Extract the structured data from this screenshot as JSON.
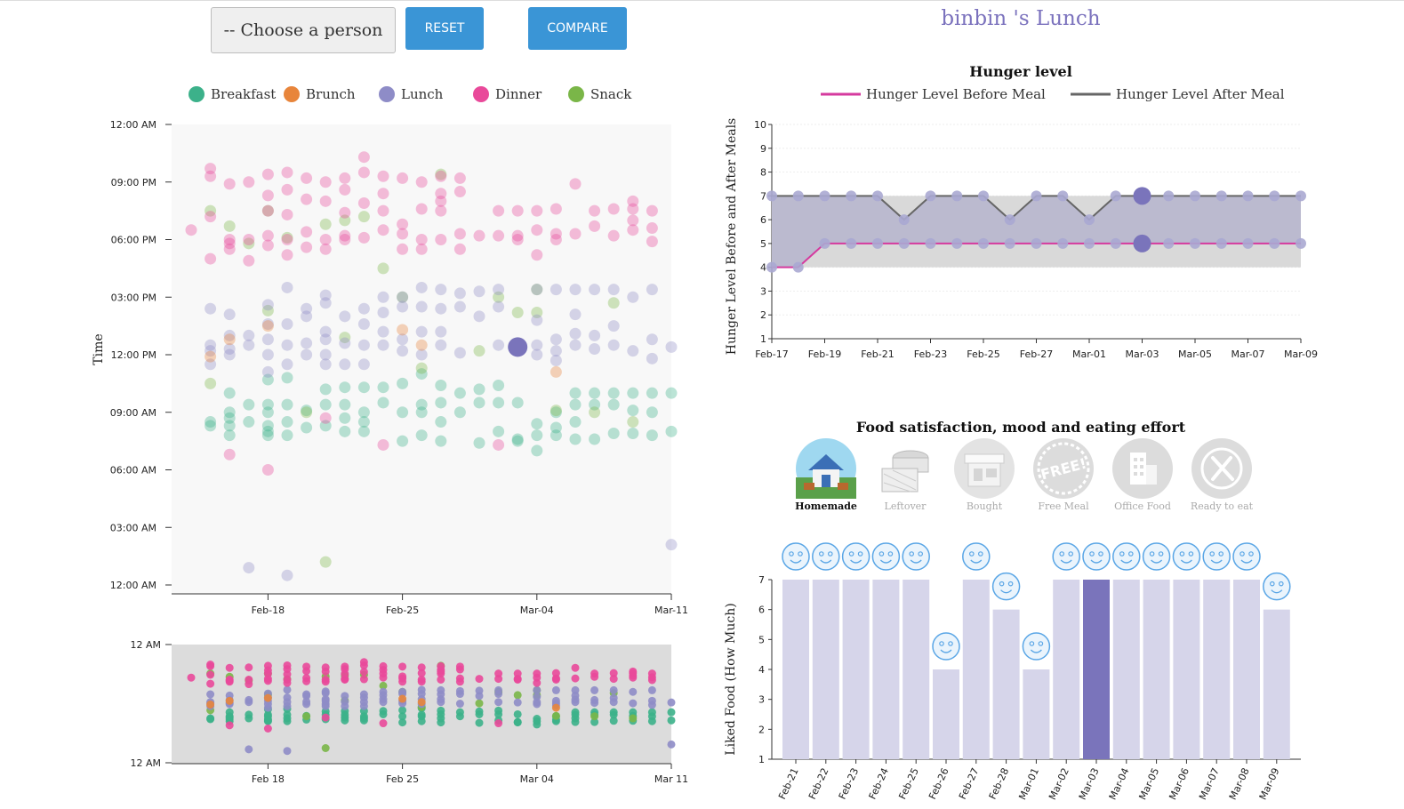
{
  "controls": {
    "person_placeholder": "-- Choose a person",
    "reset_label": "RESET",
    "compare_label": "COMPARE"
  },
  "page_title": "binbin 's Lunch",
  "colors": {
    "breakfast": "#3cb18a",
    "brunch": "#e8853b",
    "lunch": "#8e8cc7",
    "dinner": "#e9499a",
    "snack": "#7ab648",
    "highlight": "#7a74bb",
    "bar": "#d6d5ea",
    "bar_selected": "#7a74bb",
    "smiley": "#5aa6e6",
    "button": "#3a95d6",
    "hunger_before": "#d53a9e",
    "hunger_after": "#666666"
  },
  "meal_legend": [
    {
      "label": "Breakfast",
      "color": "#3cb18a"
    },
    {
      "label": "Brunch",
      "color": "#e8853b"
    },
    {
      "label": "Lunch",
      "color": "#8e8cc7"
    },
    {
      "label": "Dinner",
      "color": "#e9499a"
    },
    {
      "label": "Snack",
      "color": "#7ab648"
    }
  ],
  "chart_data": [
    {
      "type": "scatter",
      "name": "meal-times",
      "ylabel": "Time",
      "y_ticks": [
        "12:00 AM",
        "03:00 AM",
        "06:00 AM",
        "09:00 AM",
        "12:00 PM",
        "03:00 PM",
        "06:00 PM",
        "09:00 PM",
        "12:00 AM"
      ],
      "x_ticks": [
        "Feb-18",
        "Feb-25",
        "Mar-04",
        "Mar-11"
      ],
      "x_range": [
        "2018-02-14",
        "2018-03-11"
      ],
      "y_range_hours": [
        0,
        24
      ],
      "selected_point": {
        "date": "2018-03-03",
        "hour": 12.4,
        "meal": "Lunch"
      },
      "points": [
        {
          "d": "2018-02-14",
          "meals": {
            "dinner": [
              18.5
            ]
          }
        },
        {
          "d": "2018-02-15",
          "meals": {
            "breakfast": [
              8.3,
              8.5
            ],
            "brunch": [
              11.9
            ],
            "lunch": [
              11.5,
              12.2,
              12.5,
              14.4
            ],
            "dinner": [
              17,
              19.2,
              21.3,
              21.7
            ],
            "snack": [
              19.5,
              10.5
            ]
          }
        },
        {
          "d": "2018-02-16",
          "meals": {
            "breakfast": [
              7.8,
              8.3,
              8.7,
              9,
              10
            ],
            "brunch": [
              12.8
            ],
            "lunch": [
              12,
              12.3,
              13,
              14.1
            ],
            "dinner": [
              6.8,
              17.5,
              17.8,
              18,
              20.9
            ],
            "snack": [
              18.7
            ]
          }
        },
        {
          "d": "2018-02-17",
          "meals": {
            "breakfast": [
              8.5,
              9.4
            ],
            "lunch": [
              12.5,
              13,
              0.9
            ],
            "dinner": [
              16.9,
              18,
              21
            ],
            "snack": [
              17.8
            ]
          }
        },
        {
          "d": "2018-02-18",
          "meals": {
            "breakfast": [
              7.8,
              8,
              8.3,
              9,
              9.4,
              10.7
            ],
            "brunch": [
              13.5
            ],
            "lunch": [
              11.1,
              12,
              12.8,
              13.6,
              14.6
            ],
            "dinner": [
              6,
              17.7,
              18.2,
              19.5,
              20.3,
              21.4
            ],
            "snack": [
              14.3,
              19.5
            ]
          }
        },
        {
          "d": "2018-02-19",
          "meals": {
            "breakfast": [
              7.8,
              8.5,
              9.4,
              10.8
            ],
            "lunch": [
              11.5,
              12.5,
              13.6,
              15.5,
              0.5
            ],
            "dinner": [
              17.2,
              18,
              19.3,
              20.6,
              21.5
            ],
            "snack": [
              18.1
            ]
          }
        },
        {
          "d": "2018-02-20",
          "meals": {
            "breakfast": [
              8.2,
              9.1
            ],
            "lunch": [
              12,
              12.6,
              14,
              14.4
            ],
            "dinner": [
              17.6,
              18.4,
              20.1,
              21.2
            ],
            "snack": [
              9
            ]
          }
        },
        {
          "d": "2018-02-21",
          "meals": {
            "breakfast": [
              8.3,
              9.4,
              10.2
            ],
            "lunch": [
              11.5,
              12,
              12.8,
              13.2,
              14.7,
              15.1
            ],
            "dinner": [
              8.7,
              17.5,
              18,
              20,
              21
            ],
            "snack": [
              18.8,
              1.2
            ]
          }
        },
        {
          "d": "2018-02-22",
          "meals": {
            "breakfast": [
              8,
              8.7,
              9.4,
              10.3
            ],
            "lunch": [
              11.5,
              12.6,
              14
            ],
            "dinner": [
              18,
              18.2,
              19.4,
              20.6,
              21.2
            ],
            "snack": [
              12.9,
              19
            ]
          }
        },
        {
          "d": "2018-02-23",
          "meals": {
            "breakfast": [
              8,
              8.5,
              9,
              10.3
            ],
            "lunch": [
              11.5,
              12.5,
              13.6,
              14.4
            ],
            "dinner": [
              18.1,
              19.9,
              21.5,
              22.3
            ],
            "snack": [
              19.2
            ]
          }
        },
        {
          "d": "2018-02-24",
          "meals": {
            "breakfast": [
              9.5,
              10.3
            ],
            "lunch": [
              12.5,
              13.2,
              14.2,
              15
            ],
            "dinner": [
              7.3,
              18.5,
              19.5,
              20.4,
              21.3
            ],
            "snack": [
              16.5
            ]
          }
        },
        {
          "d": "2018-02-25",
          "meals": {
            "breakfast": [
              7.5,
              9,
              10.5
            ],
            "brunch": [
              13.3
            ],
            "lunch": [
              12.2,
              12.8,
              14.5,
              15
            ],
            "dinner": [
              17.5,
              18.3,
              18.8,
              21.2
            ],
            "snack": [
              15
            ]
          }
        },
        {
          "d": "2018-02-26",
          "meals": {
            "breakfast": [
              7.8,
              9,
              9.4,
              11
            ],
            "brunch": [
              12.5
            ],
            "lunch": [
              12,
              13.2,
              14.5,
              15.5
            ],
            "dinner": [
              17.5,
              18,
              19.6,
              21
            ],
            "snack": [
              11.3
            ]
          }
        },
        {
          "d": "2018-02-27",
          "meals": {
            "breakfast": [
              7.5,
              8.5,
              9.5,
              10.4
            ],
            "lunch": [
              12.5,
              13.2,
              14.4,
              15.4
            ],
            "dinner": [
              18,
              19.5,
              20,
              20.4,
              21.3
            ],
            "snack": [
              21.4
            ]
          }
        },
        {
          "d": "2018-02-28",
          "meals": {
            "breakfast": [
              9,
              10
            ],
            "lunch": [
              12.1,
              14.5,
              15.2
            ],
            "dinner": [
              17.5,
              18.3,
              20.5,
              21.2
            ],
            "snack": []
          }
        },
        {
          "d": "2018-03-01",
          "meals": {
            "breakfast": [
              7.4,
              9.5,
              10.2
            ],
            "lunch": [
              14,
              15.3
            ],
            "dinner": [
              18.2
            ],
            "snack": [
              12.2
            ]
          }
        },
        {
          "d": "2018-03-02",
          "meals": {
            "breakfast": [
              8,
              9.5,
              10.4
            ],
            "lunch": [
              12.5,
              14.5,
              15.4
            ],
            "dinner": [
              7.3,
              18.2,
              19.5
            ],
            "snack": [
              15
            ]
          }
        },
        {
          "d": "2018-03-03",
          "meals": {
            "breakfast": [
              7.5,
              7.6,
              9.5
            ],
            "lunch": [
              12.4
            ],
            "dinner": [
              18,
              18.2,
              19.5
            ],
            "snack": [
              14.2
            ]
          }
        },
        {
          "d": "2018-03-04",
          "meals": {
            "breakfast": [
              7,
              7.8,
              8.4
            ],
            "lunch": [
              12,
              12.5,
              13.8,
              15.4
            ],
            "dinner": [
              17.2,
              18.5,
              19.5
            ],
            "snack": [
              14.2,
              15.4
            ]
          }
        },
        {
          "d": "2018-03-05",
          "meals": {
            "breakfast": [
              7.8,
              8.2,
              9
            ],
            "brunch": [
              11.1
            ],
            "lunch": [
              11.7,
              12.2,
              12.8,
              15.4
            ],
            "dinner": [
              18,
              18.3,
              19.6
            ],
            "snack": [
              9.1
            ]
          }
        },
        {
          "d": "2018-03-06",
          "meals": {
            "breakfast": [
              7.6,
              8.5,
              9.4,
              10
            ],
            "lunch": [
              12.5,
              13.1,
              14.1,
              15.4
            ],
            "dinner": [
              18.3,
              20.9
            ],
            "snack": []
          }
        },
        {
          "d": "2018-03-07",
          "meals": {
            "breakfast": [
              7.6,
              9.4,
              10
            ],
            "lunch": [
              12.3,
              13,
              15.4
            ],
            "dinner": [
              18.7,
              19.5
            ],
            "snack": [
              9
            ]
          }
        },
        {
          "d": "2018-03-08",
          "meals": {
            "breakfast": [
              7.9,
              9.4,
              10
            ],
            "lunch": [
              12.5,
              13.5,
              15.4
            ],
            "dinner": [
              18.2,
              19.6
            ],
            "snack": [
              14.7
            ]
          }
        },
        {
          "d": "2018-03-09",
          "meals": {
            "breakfast": [
              7.9,
              9.1,
              10
            ],
            "lunch": [
              12.2,
              15
            ],
            "dinner": [
              18.5,
              19,
              19.6,
              20
            ],
            "snack": [
              8.5
            ]
          }
        },
        {
          "d": "2018-03-10",
          "meals": {
            "breakfast": [
              7.8,
              9,
              10
            ],
            "lunch": [
              11.8,
              12.8,
              15.4
            ],
            "dinner": [
              17.9,
              18.6,
              19.5
            ],
            "snack": []
          }
        },
        {
          "d": "2018-03-11",
          "meals": {
            "breakfast": [
              8,
              10
            ],
            "lunch": [
              12.4,
              2.1
            ],
            "dinner": [],
            "snack": []
          }
        }
      ]
    },
    {
      "type": "scatter",
      "name": "meal-times-overview",
      "y_ticks": [
        "12 AM",
        "12 AM"
      ],
      "x_ticks": [
        "Feb 18",
        "Feb 25",
        "Mar 04",
        "Mar 11"
      ]
    },
    {
      "type": "line",
      "title": "Hunger level",
      "ylabel": "Hunger Level Before and After Meals",
      "x_ticks": [
        "Feb-17",
        "Feb-19",
        "Feb-21",
        "Feb-23",
        "Feb-25",
        "Feb-27",
        "Mar-01",
        "Mar-03",
        "Mar-05",
        "Mar-07",
        "Mar-09"
      ],
      "ylim": [
        1,
        10
      ],
      "y_ticks": [
        1,
        2,
        3,
        4,
        5,
        6,
        7,
        8,
        9,
        10
      ],
      "x": [
        "Feb-17",
        "Feb-18",
        "Feb-19",
        "Feb-20",
        "Feb-21",
        "Feb-22",
        "Feb-23",
        "Feb-24",
        "Feb-25",
        "Feb-26",
        "Feb-27",
        "Feb-28",
        "Mar-01",
        "Mar-02",
        "Mar-03",
        "Mar-04",
        "Mar-05",
        "Mar-06",
        "Mar-07",
        "Mar-08",
        "Mar-09"
      ],
      "series": [
        {
          "name": "Hunger Level Before Meal",
          "values": [
            4,
            4,
            5,
            5,
            5,
            5,
            5,
            5,
            5,
            5,
            5,
            5,
            5,
            5,
            5,
            5,
            5,
            5,
            5,
            5,
            5
          ]
        },
        {
          "name": "Hunger Level After Meal",
          "values": [
            7,
            7,
            7,
            7,
            7,
            6,
            7,
            7,
            7,
            6,
            7,
            7,
            6,
            7,
            7,
            7,
            7,
            7,
            7,
            7,
            7
          ]
        }
      ],
      "highlight_x": "Mar-03",
      "legend": "top"
    },
    {
      "type": "bar",
      "title": "Food satisfaction, mood and eating effort",
      "ylabel": "Liked Food (How Much)",
      "categories": [
        "Feb-21",
        "Feb-22",
        "Feb-23",
        "Feb-24",
        "Feb-25",
        "Feb-26",
        "Feb-27",
        "Feb-28",
        "Mar-01",
        "Mar-02",
        "Mar-03",
        "Mar-04",
        "Mar-05",
        "Mar-06",
        "Mar-07",
        "Mar-08",
        "Mar-09"
      ],
      "values": [
        7,
        7,
        7,
        7,
        7,
        4,
        7,
        6,
        4,
        7,
        7,
        7,
        7,
        7,
        7,
        7,
        6
      ],
      "ylim": [
        1,
        7
      ],
      "y_ticks": [
        1,
        2,
        3,
        4,
        5,
        6,
        7
      ],
      "selected_category": "Mar-03"
    }
  ],
  "food_sources": [
    {
      "label": "Homemade",
      "icon": "house-icon",
      "active": true
    },
    {
      "label": "Leftover",
      "icon": "leftover-icon",
      "active": false
    },
    {
      "label": "Bought",
      "icon": "store-icon",
      "active": false
    },
    {
      "label": "Free Meal",
      "icon": "free-stamp-icon",
      "active": false
    },
    {
      "label": "Office Food",
      "icon": "office-building-icon",
      "active": false
    },
    {
      "label": "Ready to eat",
      "icon": "fork-knife-icon",
      "active": false
    }
  ]
}
